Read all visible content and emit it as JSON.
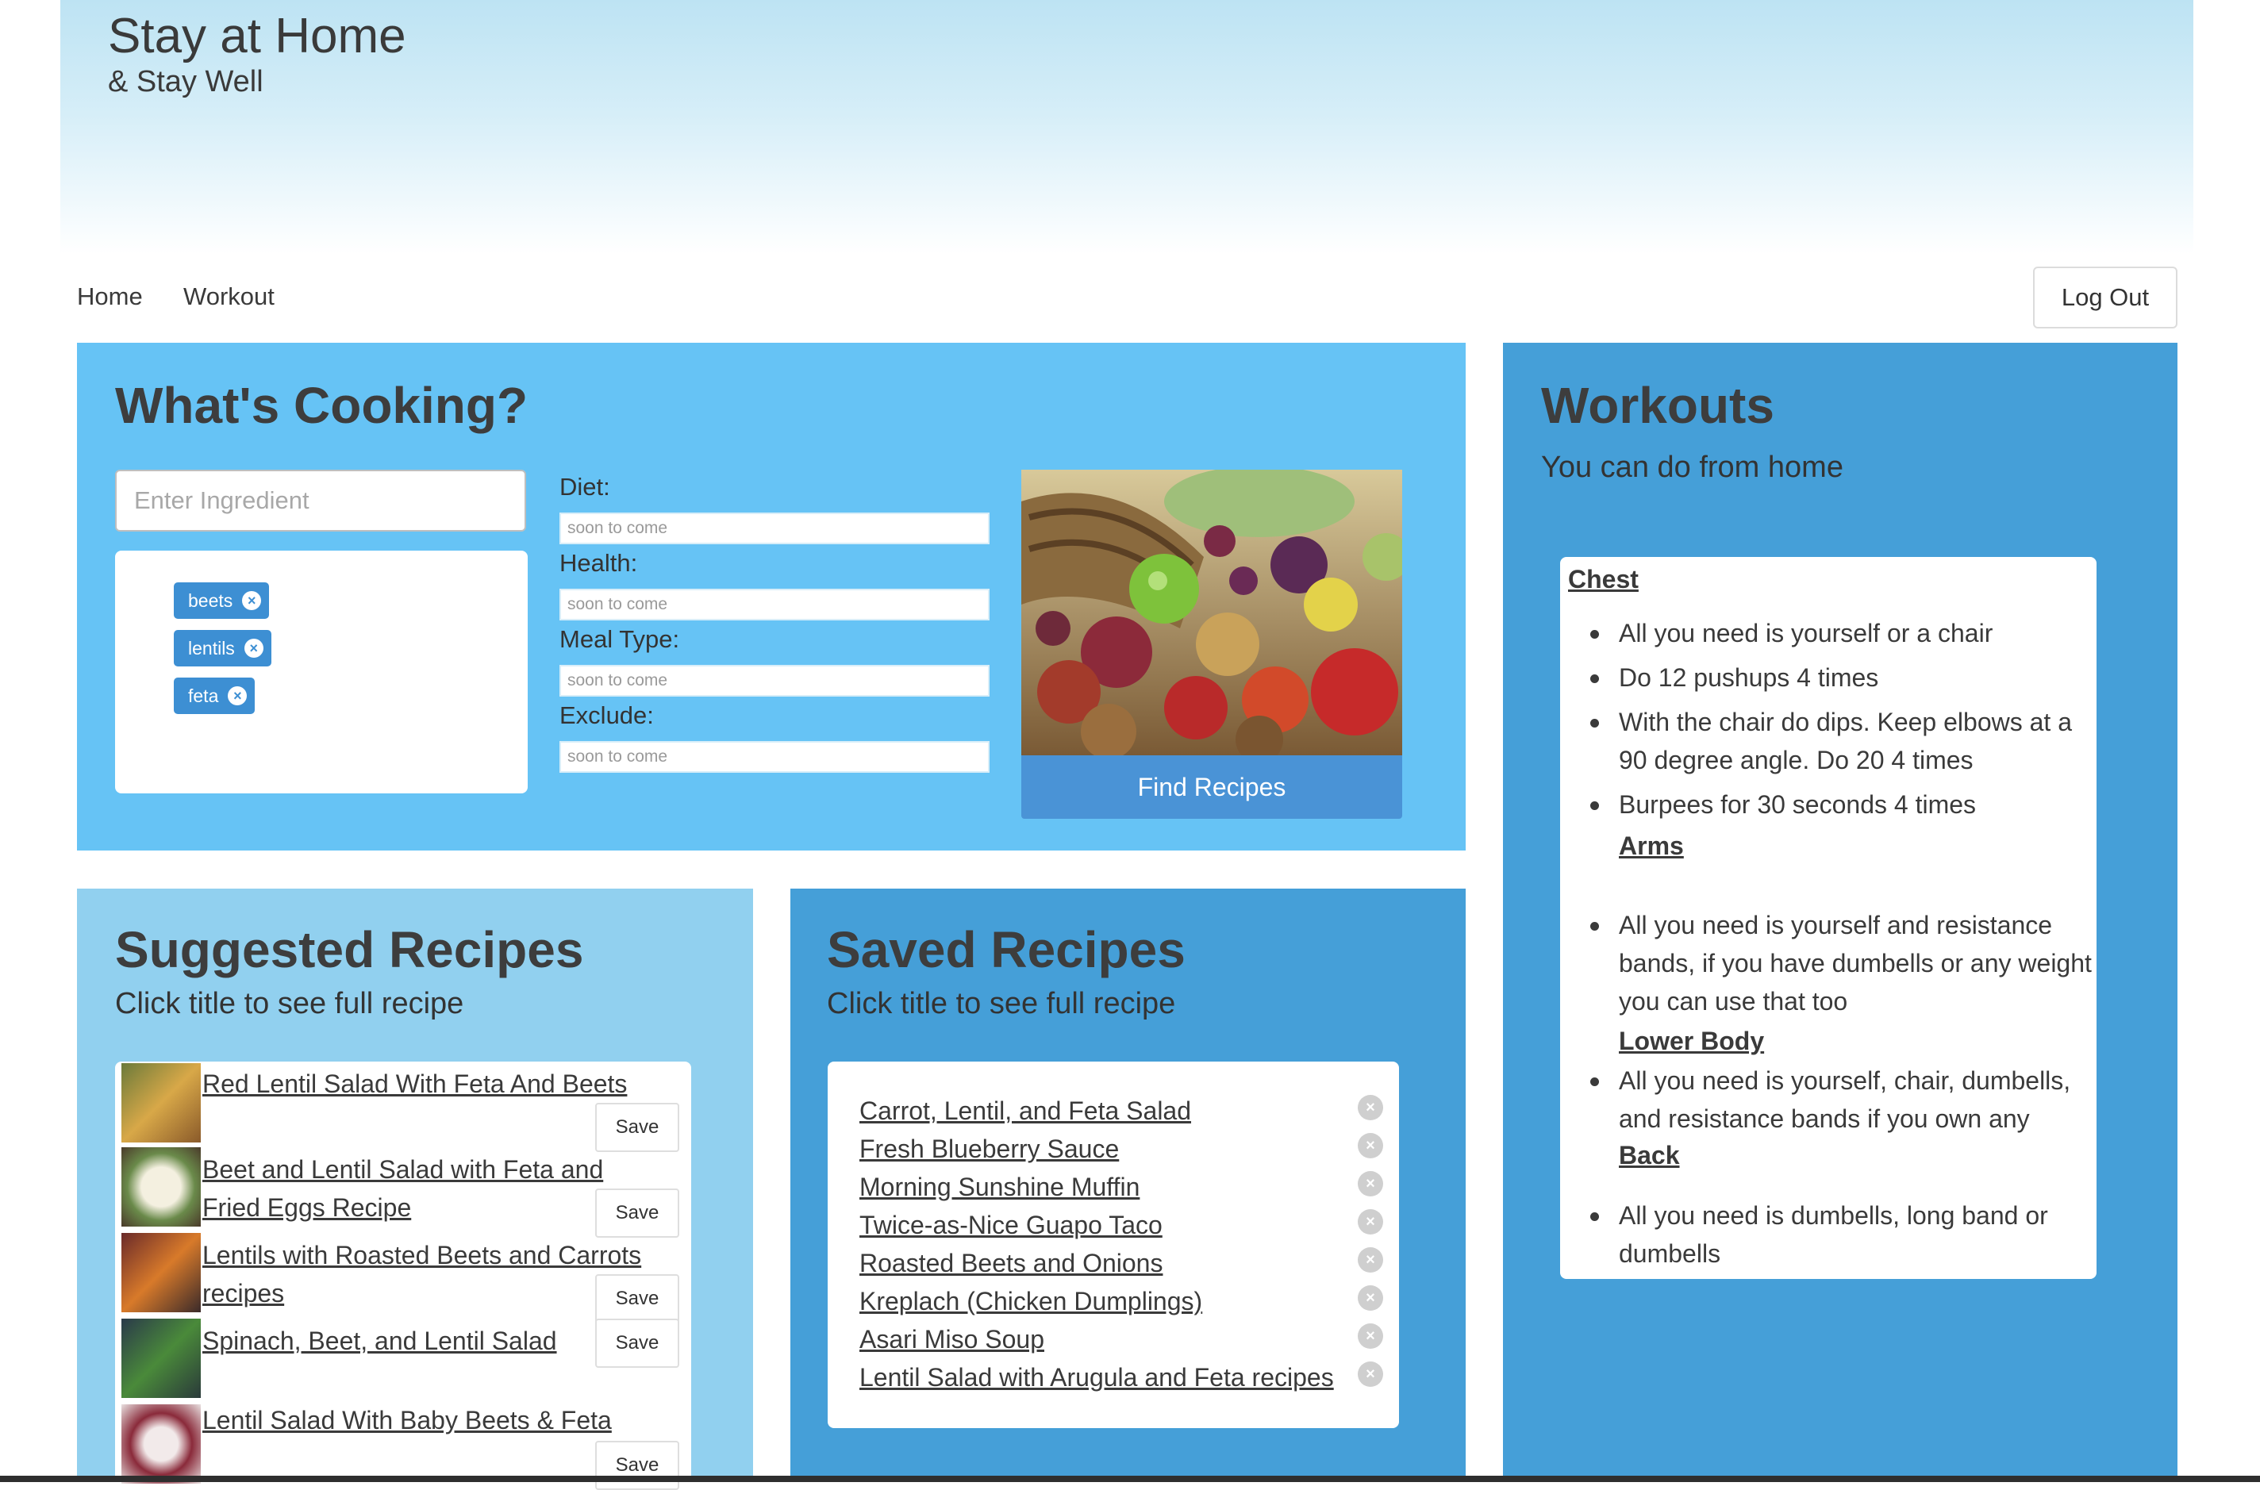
{
  "header": {
    "title": "Stay at Home",
    "subtitle": "& Stay Well"
  },
  "nav": {
    "home": "Home",
    "workout": "Workout",
    "logout": "Log Out"
  },
  "cooking": {
    "title": "What's Cooking?",
    "ingredient_placeholder": "Enter Ingredient",
    "tags": [
      "beets",
      "lentils",
      "feta"
    ],
    "fields": [
      {
        "label": "Diet:",
        "placeholder": "soon to come"
      },
      {
        "label": "Health:",
        "placeholder": "soon to come"
      },
      {
        "label": "Meal Type:",
        "placeholder": "soon to come"
      },
      {
        "label": "Exclude:",
        "placeholder": "soon to come"
      }
    ],
    "find_label": "Find Recipes"
  },
  "suggested": {
    "title": "Suggested Recipes",
    "subtitle": "Click title to see full recipe",
    "save_label": "Save",
    "items": [
      "Red Lentil Salad With Feta And Beets",
      "Beet and Lentil Salad with Feta and Fried Eggs Recipe",
      "Lentils with Roasted Beets and Carrots recipes",
      "Spinach, Beet, and Lentil Salad",
      "Lentil Salad With Baby Beets & Feta"
    ]
  },
  "saved": {
    "title": "Saved Recipes",
    "subtitle": "Click title to see full recipe",
    "items": [
      "Carrot, Lentil, and Feta Salad",
      "Fresh Blueberry Sauce",
      "Morning Sunshine Muffin",
      "Twice-as-Nice Guapo Taco",
      "Roasted Beets and Onions",
      "Kreplach (Chicken Dumplings)",
      "Asari Miso Soup",
      "Lentil Salad with Arugula and Feta recipes"
    ]
  },
  "workouts": {
    "title": "Workouts",
    "subtitle": "You can do from home",
    "chest_heading": "Chest",
    "chest_items": [
      "All you need is yourself or a chair",
      "Do 12 pushups 4 times",
      "With the chair do dips. Keep elbows at a 90 degree angle. Do 20 4 times",
      "Burpees for 30 seconds 4 times"
    ],
    "arms_heading": "Arms",
    "arms_item": "All you need is yourself and resistance bands, if you have dumbells or any weight you can use that too",
    "lower_heading": "Lower Body",
    "lower_item": "All you need is yourself, chair, dumbells, and resistance bands if you own any",
    "back_heading": "Back",
    "back_item": "All you need is dumbells, long band or dumbells"
  },
  "colors": {
    "cooking_panel": "#66c3f5",
    "workouts_panel": "#459fd8",
    "suggested_panel": "#91d0ef",
    "saved_panel": "#459fd8",
    "tag": "#3d8fd3",
    "find_button": "#4a93d6"
  },
  "icons": {
    "tag_remove": "close-circle-icon",
    "saved_remove": "close-circle-icon"
  }
}
